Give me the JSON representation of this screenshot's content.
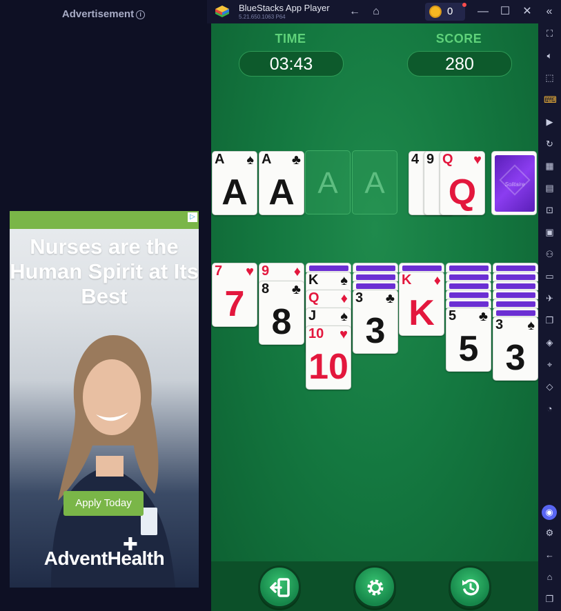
{
  "ad": {
    "header": "Advertisement",
    "headline": "Nurses are the Human Spirit at Its Best",
    "cta": "Apply Today",
    "brand": "AdventHealth"
  },
  "window": {
    "title": "BlueStacks App Player",
    "version": "5.21.650.1063  P64",
    "coins": "0"
  },
  "game": {
    "time_label": "TIME",
    "time_value": "03:43",
    "score_label": "SCORE",
    "score_value": "280",
    "placeholder_label": "A",
    "stock_logo": "Solitaire",
    "foundations": [
      {
        "rank": "A",
        "suit": "♠",
        "color": "black"
      },
      {
        "rank": "A",
        "suit": "♣",
        "color": "black"
      }
    ],
    "waste": [
      {
        "rank": "4",
        "color": "black"
      },
      {
        "rank": "9",
        "color": "black"
      },
      {
        "rank": "Q",
        "suit": "♥",
        "color": "red"
      }
    ],
    "tableau": [
      {
        "hidden": 0,
        "cards": [
          {
            "rank": "7",
            "suit": "♥",
            "color": "red"
          }
        ]
      },
      {
        "hidden": 0,
        "cards": [
          {
            "rank": "9",
            "suit": "♦",
            "color": "red"
          },
          {
            "rank": "8",
            "suit": "♣",
            "color": "black"
          }
        ]
      },
      {
        "hidden": 1,
        "cards": [
          {
            "rank": "K",
            "suit": "♠",
            "color": "black"
          },
          {
            "rank": "Q",
            "suit": "♦",
            "color": "red"
          },
          {
            "rank": "J",
            "suit": "♠",
            "color": "black"
          },
          {
            "rank": "10",
            "suit": "♥",
            "color": "red"
          }
        ]
      },
      {
        "hidden": 3,
        "cards": [
          {
            "rank": "3",
            "suit": "♣",
            "color": "black"
          }
        ]
      },
      {
        "hidden": 1,
        "cards": [
          {
            "rank": "K",
            "suit": "♦",
            "color": "red"
          }
        ]
      },
      {
        "hidden": 5,
        "cards": [
          {
            "rank": "5",
            "suit": "♣",
            "color": "black"
          }
        ]
      },
      {
        "hidden": 6,
        "cards": [
          {
            "rank": "3",
            "suit": "♠",
            "color": "black"
          }
        ]
      }
    ]
  },
  "colors": {
    "felt": "#147840",
    "card_back": "#6b2fd3",
    "red_suit": "#e3173d",
    "ad_green": "#7ab648"
  }
}
